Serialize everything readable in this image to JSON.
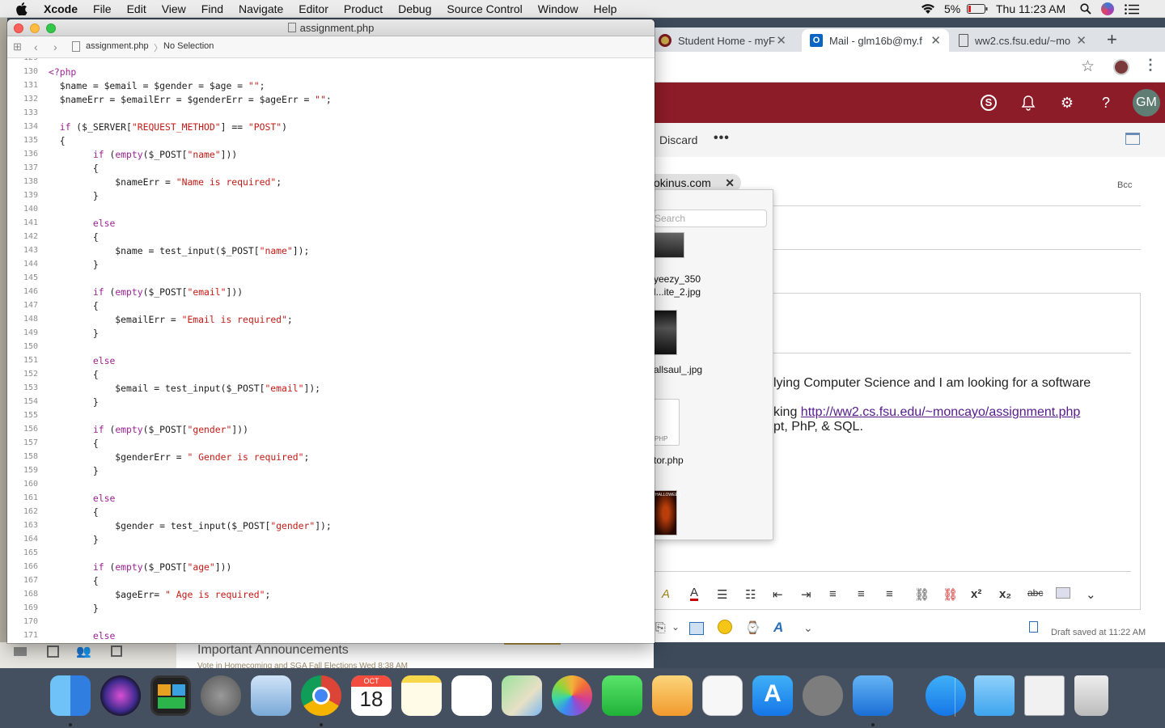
{
  "menubar": {
    "menus": [
      "Xcode",
      "File",
      "Edit",
      "View",
      "Find",
      "Navigate",
      "Editor",
      "Product",
      "Debug",
      "Source Control",
      "Window",
      "Help"
    ],
    "battery": "5%",
    "clock": "Thu 11:23 AM"
  },
  "chrome": {
    "tabs": [
      {
        "title": "Student Home - myF",
        "icon": "fsu-seal-icon"
      },
      {
        "title": "Mail - glm16b@my.f",
        "icon": "outlook-icon"
      },
      {
        "title": "ww2.cs.fsu.edu/~mo",
        "icon": "page-icon"
      }
    ],
    "new_tab": "+",
    "owa": {
      "avatar_initials": "GM",
      "discard_label": "Discard",
      "more_label": "•••",
      "recipient_chip": "okinus.com",
      "bcc_label": "Bcc",
      "body_line1": "lying Computer Science and I am looking for a software",
      "body_line2_prefix": "king ",
      "body_link": "http://ww2.cs.fsu.edu/~moncayo/assignment.php",
      "body_line3": "pt, PhP, & SQL.",
      "draft_status": "Draft saved at 11:22 AM"
    },
    "picker": {
      "search_placeholder": "Search",
      "items": [
        "yeezy_350",
        "l...ite_2.jpg",
        "allsaul_.jpg",
        "tor.php"
      ],
      "php_badge": "PHP",
      "halloween_text": "HALLOWEEN"
    }
  },
  "background_window": {
    "announcement_title": "Important Announcements",
    "announcement_sub": "Vote in Homecoming and SGA Fall Elections     Wed 8:38 AM"
  },
  "xcode": {
    "window_title": "assignment.php",
    "breadcrumb_file": "assignment.php",
    "breadcrumb_sep": "〉",
    "breadcrumb_selection": "No Selection",
    "line_numbers": [
      "129",
      "130",
      "131",
      "132",
      "133",
      "134",
      "135",
      "136",
      "137",
      "138",
      "139",
      "140",
      "141",
      "142",
      "143",
      "144",
      "145",
      "146",
      "147",
      "148",
      "149",
      "150",
      "151",
      "152",
      "153",
      "154",
      "155",
      "156",
      "157",
      "158",
      "159",
      "160",
      "161",
      "162",
      "163",
      "164",
      "165",
      "166",
      "167",
      "168",
      "169",
      "170",
      "171"
    ],
    "code": [
      [],
      [
        {
          "t": "<?php",
          "c": "kw"
        }
      ],
      [
        {
          "t": "  $name = $email = $gender = $age = "
        },
        {
          "t": "\"\"",
          "c": "str"
        },
        {
          "t": ";"
        }
      ],
      [
        {
          "t": "  $nameErr = $emailErr = $genderErr = $ageErr = "
        },
        {
          "t": "\"\"",
          "c": "str"
        },
        {
          "t": ";"
        }
      ],
      [],
      [
        {
          "t": "  "
        },
        {
          "t": "if",
          "c": "kw"
        },
        {
          "t": " ($_SERVER["
        },
        {
          "t": "\"REQUEST_METHOD\"",
          "c": "str"
        },
        {
          "t": "] == "
        },
        {
          "t": "\"POST\"",
          "c": "str"
        },
        {
          "t": ")"
        }
      ],
      [
        {
          "t": "  {"
        }
      ],
      [
        {
          "t": "        "
        },
        {
          "t": "if",
          "c": "kw"
        },
        {
          "t": " ("
        },
        {
          "t": "empty",
          "c": "kw"
        },
        {
          "t": "($_POST["
        },
        {
          "t": "\"name\"",
          "c": "str"
        },
        {
          "t": "]))"
        }
      ],
      [
        {
          "t": "        {"
        }
      ],
      [
        {
          "t": "            $nameErr = "
        },
        {
          "t": "\"Name is required\"",
          "c": "str"
        },
        {
          "t": ";"
        }
      ],
      [
        {
          "t": "        }"
        }
      ],
      [],
      [
        {
          "t": "        "
        },
        {
          "t": "else",
          "c": "kw"
        }
      ],
      [
        {
          "t": "        {"
        }
      ],
      [
        {
          "t": "            $name = test_input($_POST["
        },
        {
          "t": "\"name\"",
          "c": "str"
        },
        {
          "t": "]);"
        }
      ],
      [
        {
          "t": "        }"
        }
      ],
      [],
      [
        {
          "t": "        "
        },
        {
          "t": "if",
          "c": "kw"
        },
        {
          "t": " ("
        },
        {
          "t": "empty",
          "c": "kw"
        },
        {
          "t": "($_POST["
        },
        {
          "t": "\"email\"",
          "c": "str"
        },
        {
          "t": "]))"
        }
      ],
      [
        {
          "t": "        {"
        }
      ],
      [
        {
          "t": "            $emailErr = "
        },
        {
          "t": "\"Email is required\"",
          "c": "str"
        },
        {
          "t": ";"
        }
      ],
      [
        {
          "t": "        }"
        }
      ],
      [],
      [
        {
          "t": "        "
        },
        {
          "t": "else",
          "c": "kw"
        }
      ],
      [
        {
          "t": "        {"
        }
      ],
      [
        {
          "t": "            $email = test_input($_POST["
        },
        {
          "t": "\"email\"",
          "c": "str"
        },
        {
          "t": "]);"
        }
      ],
      [
        {
          "t": "        }"
        }
      ],
      [],
      [
        {
          "t": "        "
        },
        {
          "t": "if",
          "c": "kw"
        },
        {
          "t": " ("
        },
        {
          "t": "empty",
          "c": "kw"
        },
        {
          "t": "($_POST["
        },
        {
          "t": "\"gender\"",
          "c": "str"
        },
        {
          "t": "]))"
        }
      ],
      [
        {
          "t": "        {"
        }
      ],
      [
        {
          "t": "            $genderErr = "
        },
        {
          "t": "\" Gender is required\"",
          "c": "str"
        },
        {
          "t": ";"
        }
      ],
      [
        {
          "t": "        }"
        }
      ],
      [],
      [
        {
          "t": "        "
        },
        {
          "t": "else",
          "c": "kw"
        }
      ],
      [
        {
          "t": "        {"
        }
      ],
      [
        {
          "t": "            $gender = test_input($_POST["
        },
        {
          "t": "\"gender\"",
          "c": "str"
        },
        {
          "t": "]);"
        }
      ],
      [
        {
          "t": "        }"
        }
      ],
      [],
      [
        {
          "t": "        "
        },
        {
          "t": "if",
          "c": "kw"
        },
        {
          "t": " ("
        },
        {
          "t": "empty",
          "c": "kw"
        },
        {
          "t": "($_POST["
        },
        {
          "t": "\"age\"",
          "c": "str"
        },
        {
          "t": "]))"
        }
      ],
      [
        {
          "t": "        {"
        }
      ],
      [
        {
          "t": "            $ageErr= "
        },
        {
          "t": "\" Age is required\"",
          "c": "str"
        },
        {
          "t": ";"
        }
      ],
      [
        {
          "t": "        }"
        }
      ],
      [],
      [
        {
          "t": "        "
        },
        {
          "t": "else",
          "c": "kw"
        }
      ]
    ]
  },
  "dock": {
    "calendar_month": "OCT",
    "calendar_day": "18",
    "apps": [
      "finder",
      "siri",
      "photo-booth",
      "launchpad",
      "preview",
      "chrome",
      "calendar",
      "notes",
      "reminders",
      "maps",
      "photos",
      "facetime",
      "pages",
      "textedit",
      "app-store",
      "system-preferences",
      "xcode",
      "app-store-downloads",
      "documents-folder",
      "document-stack",
      "trash"
    ]
  },
  "colors": {
    "owa_brand": "#8d1c29",
    "php_keyword": "#9b2393",
    "php_string": "#c41a16"
  }
}
